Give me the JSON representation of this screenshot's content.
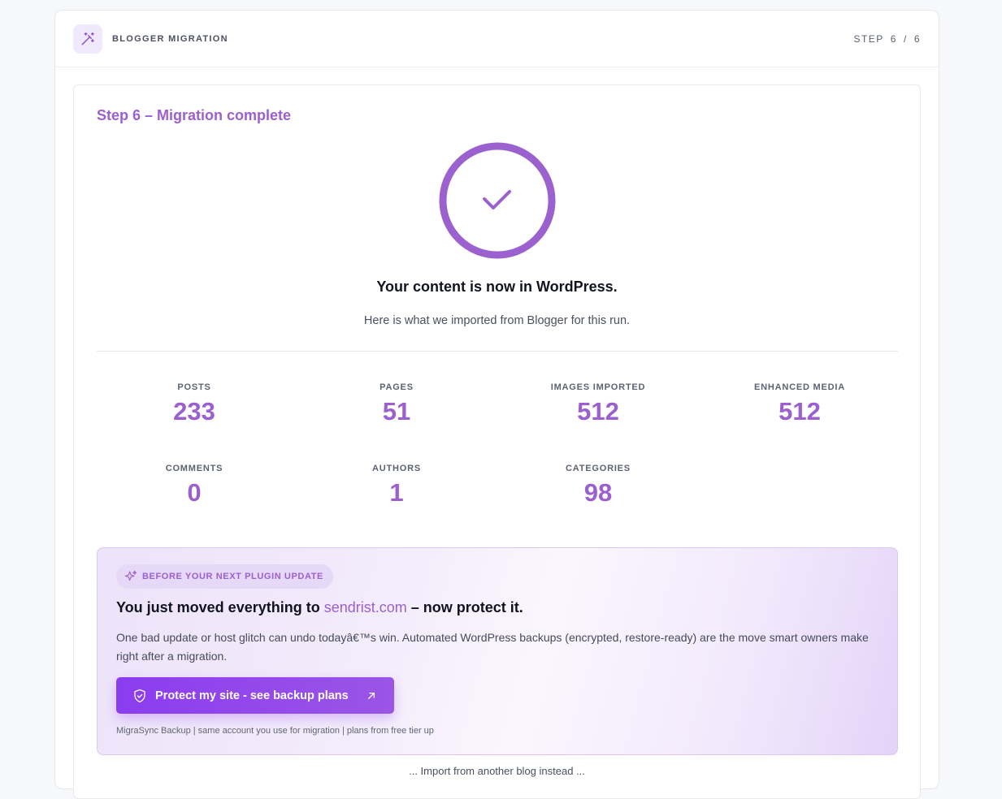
{
  "header": {
    "title": "BLOGGER MIGRATION",
    "step_label": "STEP",
    "step_current": "6",
    "step_sep": "/",
    "step_total": "6",
    "icon": "magic-wand-icon"
  },
  "step_title": "Step 6 – Migration complete",
  "success": {
    "icon": "checkmark-circle-icon",
    "headline": "Your content is now in WordPress.",
    "subline": "Here is what we imported from Blogger for this run."
  },
  "stats": [
    {
      "label": "POSTS",
      "value": "233"
    },
    {
      "label": "PAGES",
      "value": "51"
    },
    {
      "label": "IMAGES IMPORTED",
      "value": "512"
    },
    {
      "label": "ENHANCED MEDIA",
      "value": "512"
    },
    {
      "label": "COMMENTS",
      "value": "0"
    },
    {
      "label": "AUTHORS",
      "value": "1"
    },
    {
      "label": "CATEGORIES",
      "value": "98"
    }
  ],
  "promo": {
    "badge": "BEFORE YOUR NEXT PLUGIN UPDATE",
    "title_prefix": "You just moved everything to ",
    "domain": "sendrist.com",
    "title_suffix": " – now protect it.",
    "body": "One bad update or host glitch can undo todayâ€™s win. Automated WordPress backups (encrypted, restore-ready) are the move smart owners make right after a migration.",
    "button_label": "Protect my site - see backup plans",
    "footnote": "MigraSync Backup | same account you use for migration | plans from free tier up"
  },
  "bottom_text": "... Import from another blog instead ...",
  "colors": {
    "accent": "#9b5fcf",
    "button": "#8c3cf0"
  }
}
